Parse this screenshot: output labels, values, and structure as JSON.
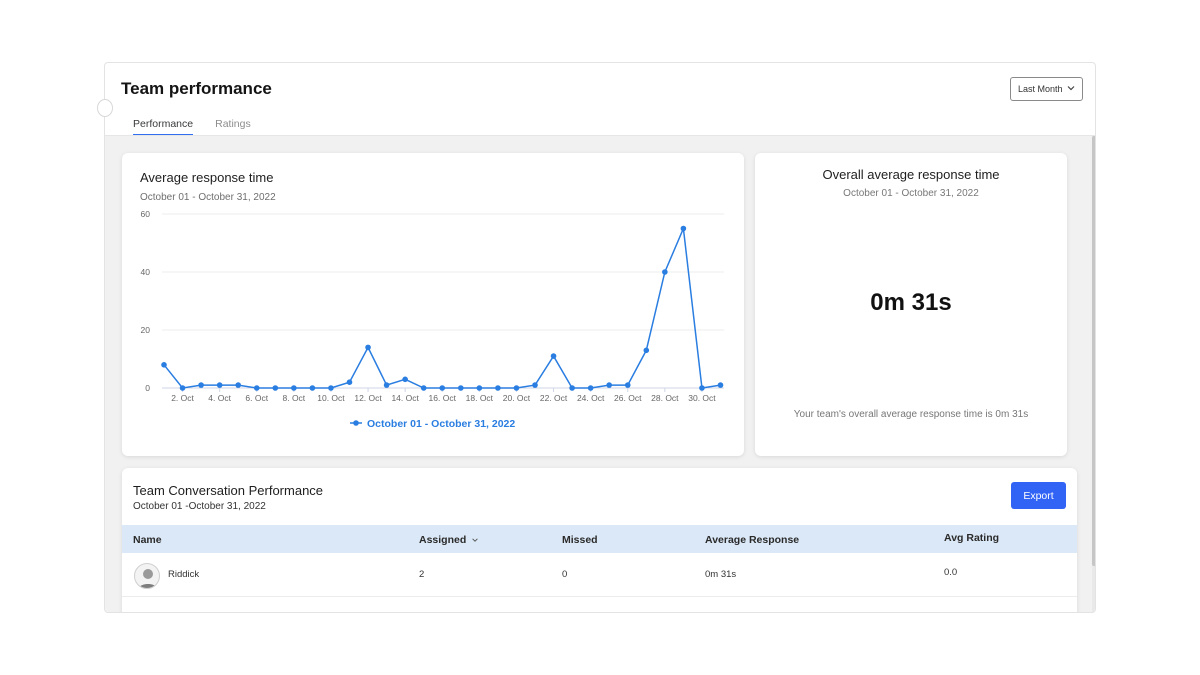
{
  "page": {
    "title": "Team performance",
    "range_select": {
      "value": "Last Month"
    },
    "tabs": [
      {
        "label": "Performance",
        "active": true
      },
      {
        "label": "Ratings",
        "active": false
      }
    ]
  },
  "avg_response_card": {
    "title": "Average response time",
    "subtitle": "October 01 - October 31, 2022"
  },
  "chart_data": {
    "type": "line",
    "title": "Average response time",
    "x": [
      1,
      2,
      3,
      4,
      5,
      6,
      7,
      8,
      9,
      10,
      11,
      12,
      13,
      14,
      15,
      16,
      17,
      18,
      19,
      20,
      21,
      22,
      23,
      24,
      25,
      26,
      27,
      28,
      29,
      30,
      31
    ],
    "x_tick_labels": [
      "2. Oct",
      "4. Oct",
      "6. Oct",
      "8. Oct",
      "10. Oct",
      "12. Oct",
      "14. Oct",
      "16. Oct",
      "18. Oct",
      "20. Oct",
      "22. Oct",
      "24. Oct",
      "26. Oct",
      "28. Oct",
      "30. Oct"
    ],
    "series": [
      {
        "name": "October 01 - October 31, 2022",
        "color": "#2a7de1",
        "values": [
          8,
          0,
          1,
          1,
          1,
          0,
          0,
          0,
          0,
          0,
          2,
          14,
          1,
          3,
          0,
          0,
          0,
          0,
          0,
          0,
          1,
          11,
          0,
          0,
          1,
          1,
          13,
          40,
          55,
          0,
          1
        ]
      }
    ],
    "ylim": [
      0,
      60
    ],
    "yticks": [
      0,
      20,
      40,
      60
    ],
    "grid": true,
    "legend_position": "bottom-center"
  },
  "overall_card": {
    "title": "Overall average response time",
    "subtitle": "October 01 - October 31, 2022",
    "value": "0m 31s",
    "note": "Your team's overall average response time is 0m 31s"
  },
  "team_table": {
    "title": "Team Conversation Performance",
    "subtitle": "October 01 -October 31, 2022",
    "export_label": "Export",
    "columns": [
      "Name",
      "Assigned",
      "Missed",
      "Average Response",
      "Avg Rating"
    ],
    "rows": [
      {
        "name": "Riddick",
        "assigned": "2",
        "missed": "0",
        "average_response": "0m 31s",
        "avg_rating": "0.0"
      }
    ]
  },
  "colors": {
    "accent": "#3163f5",
    "series": "#2a7de1",
    "table_header": "#dbe8f7"
  }
}
